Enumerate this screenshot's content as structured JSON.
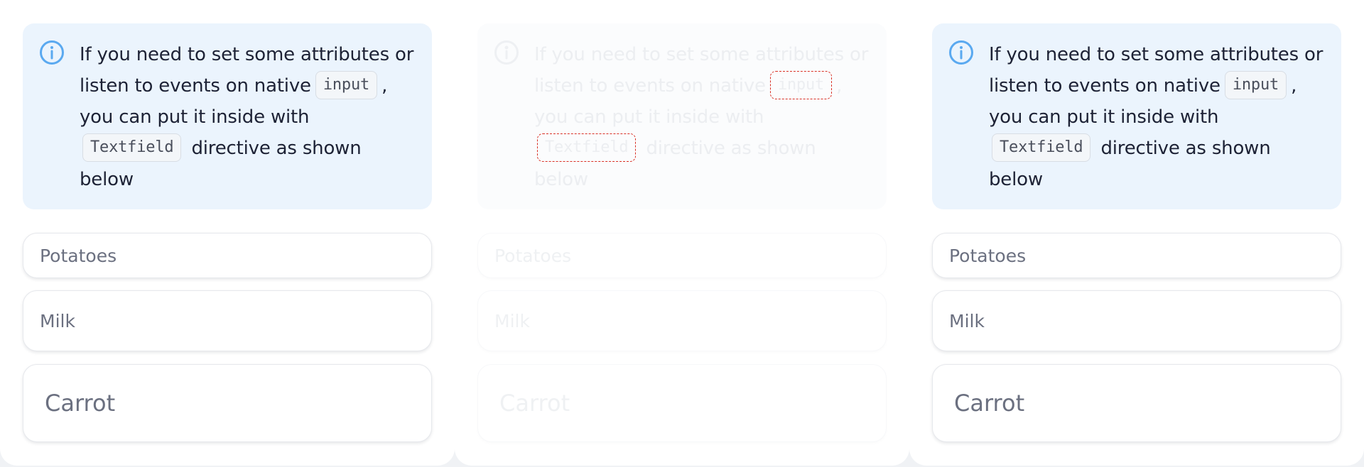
{
  "panels": [
    {
      "id": "left",
      "notice": {
        "icon": "info-icon",
        "line1": "If you need to set some attributes or",
        "line2_pre": "listen to events on native",
        "line2_code": "input",
        "line2_post": ",",
        "line3": "you can put it inside with",
        "line4_code": "Textfield",
        "line4_post": "directive as shown",
        "line5": "below"
      },
      "fields": [
        "Potatoes",
        "Milk",
        "Carrot"
      ]
    },
    {
      "id": "middle",
      "state": "faded",
      "notice": {
        "icon": "info-icon",
        "line1": "If you need to set some attributes or",
        "line2_pre": "listen to events on native",
        "line2_code": "input",
        "line2_post": ",",
        "line3": "you can put it inside with",
        "line4_code": "Textfield",
        "line4_post": "directive as shown",
        "line5": "below"
      },
      "fields": [
        "Potatoes",
        "Milk",
        "Carrot"
      ]
    },
    {
      "id": "right",
      "notice": {
        "icon": "info-icon",
        "line1": "If you need to set some attributes or",
        "line2_pre": "listen to events on native",
        "line2_code": "input",
        "line2_post": ",",
        "line3": "you can put it inside with",
        "line4_code": "Textfield",
        "line4_post": "directive as shown",
        "line5": "below"
      },
      "fields": [
        "Potatoes",
        "Milk",
        "Carrot"
      ]
    }
  ],
  "colors": {
    "notice_bg": "#ebf4fd",
    "info_icon": "#5aa9f0",
    "highlight_outline": "#d93025"
  }
}
